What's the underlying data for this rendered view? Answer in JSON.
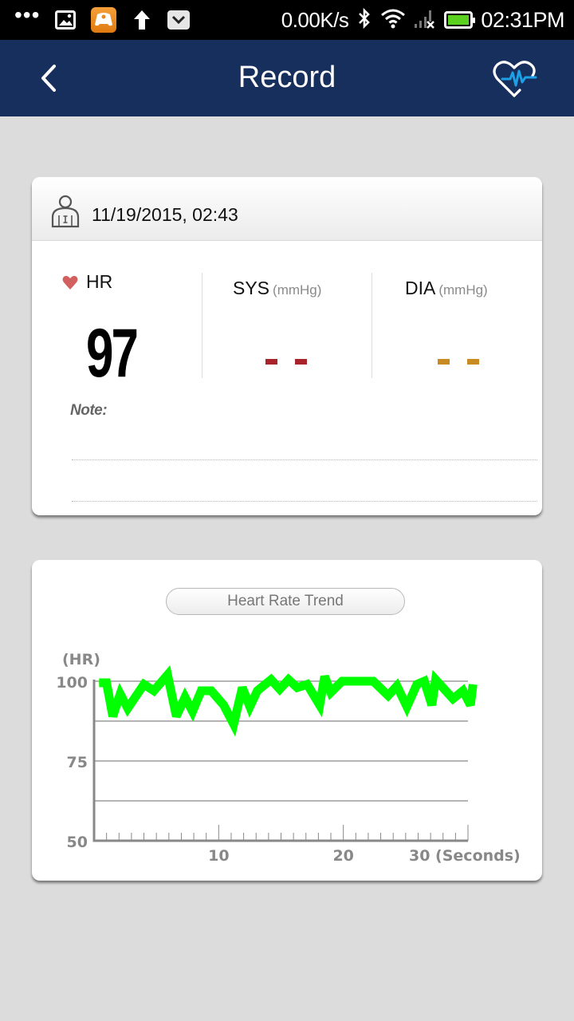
{
  "status_bar": {
    "notification_icons": [
      "more-dots-icon",
      "gallery-icon",
      "game-controller-icon",
      "upload-arrow-icon",
      "mail-icon"
    ],
    "network_speed": "0.00K/s",
    "system_icons": [
      "bluetooth-icon",
      "wifi-icon",
      "no-signal-icon",
      "battery-icon"
    ],
    "time": "02:31PM",
    "battery_color": "#59d11e"
  },
  "app_bar": {
    "title": "Record",
    "back_icon": "chevron-left-icon",
    "action_icon": "heart-pulse-icon",
    "background": "#172f5c",
    "accent": "#1ea0e6"
  },
  "record": {
    "user_icon": "user-icon",
    "datetime": "11/19/2015, 02:43",
    "hr": {
      "label": "HR",
      "icon": "heart-icon",
      "value": "97",
      "icon_color": "#d2605f"
    },
    "sys": {
      "label": "SYS",
      "unit": "(mmHg)",
      "value": "--",
      "color": "#a8232a"
    },
    "dia": {
      "label": "DIA",
      "unit": "(mmHg)",
      "value": "--",
      "color": "#c98a22"
    },
    "note_label": "Note:",
    "note_value": ""
  },
  "trend": {
    "button_label": "Heart Rate Trend"
  },
  "chart_data": {
    "type": "line",
    "title": "Heart Rate Trend",
    "xlabel": "(Seconds)",
    "ylabel": "(HR)",
    "xlim": [
      0,
      30
    ],
    "ylim": [
      50,
      100
    ],
    "x_ticks": [
      10,
      20,
      30
    ],
    "x_tick_labels": [
      "10",
      "20",
      "30 (Seconds)"
    ],
    "y_ticks": [
      50,
      75,
      100
    ],
    "y_tick_labels": [
      "50",
      "75",
      "100"
    ],
    "gridlines_y": [
      62.5,
      75,
      87.5,
      100
    ],
    "grid": true,
    "legend": "none",
    "line_color": "#00ff00",
    "series": [
      {
        "name": "HR",
        "x": [
          0.4,
          1.0,
          1.5,
          2.1,
          2.7,
          4.0,
          4.8,
          5.9,
          6.6,
          7.3,
          7.9,
          8.6,
          9.4,
          10.4,
          11.2,
          11.9,
          12.5,
          13.1,
          14.2,
          14.9,
          15.6,
          16.3,
          17.1,
          18.1,
          18.5,
          19.0,
          19.9,
          22.4,
          23.6,
          24.3,
          25.1,
          25.9,
          26.5,
          27.1,
          27.4,
          28.8,
          29.6,
          30.2,
          30.4
        ],
        "y": [
          99.5,
          99.5,
          89,
          96,
          91.5,
          99,
          97,
          102,
          89,
          95,
          90.5,
          97,
          97,
          92.5,
          86.5,
          98,
          92,
          97,
          100.5,
          97.5,
          100.5,
          98,
          99,
          92.5,
          101.5,
          96.5,
          100,
          100,
          95.5,
          98.5,
          92,
          99,
          100,
          92.5,
          100.5,
          94.5,
          97,
          92.5,
          99
        ]
      }
    ]
  }
}
